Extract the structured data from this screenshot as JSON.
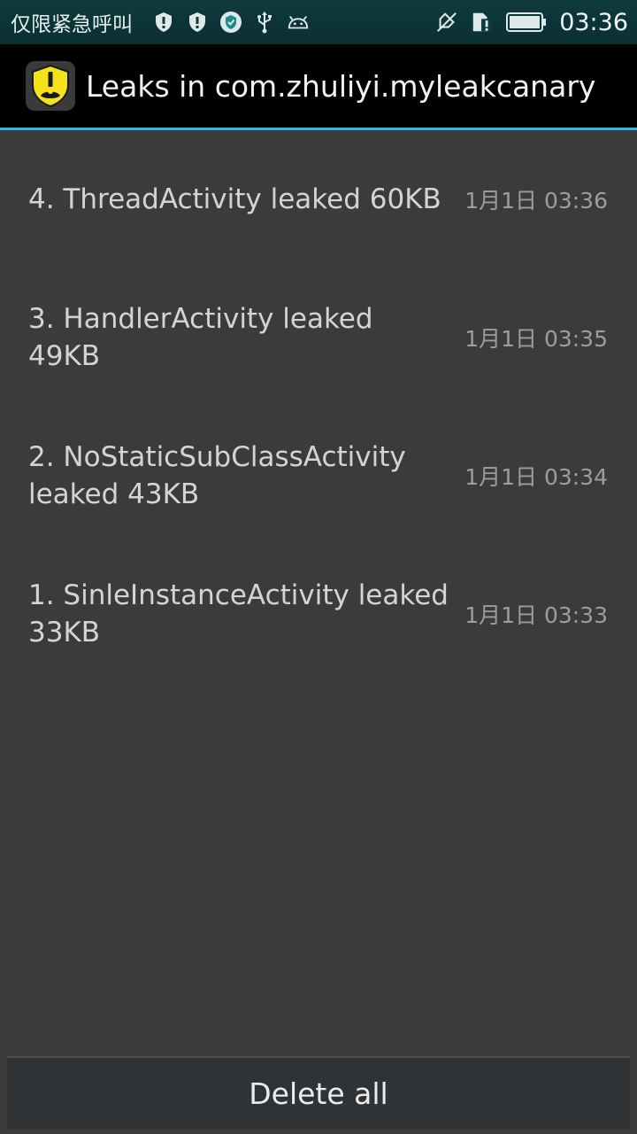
{
  "status_bar": {
    "carrier": "仅限紧急呼叫",
    "left_icons": [
      "shield-alert-icon",
      "shield-alert-icon",
      "shield-badge-icon",
      "usb-icon",
      "android-icon"
    ],
    "right_icons": [
      "mute-icon",
      "sim-alert-icon",
      "battery-icon"
    ],
    "time": "03:36"
  },
  "action_bar": {
    "title": "Leaks in com.zhuliyi.myleakcanary",
    "icon": "leakcanary-app-icon",
    "accent": "#33b5e5"
  },
  "leaks": [
    {
      "label": "4. ThreadActivity leaked 60KB",
      "time": "1月1日 03:36"
    },
    {
      "label": "3. HandlerActivity leaked 49KB",
      "time": "1月1日 03:35"
    },
    {
      "label": "2. NoStaticSubClassActivity leaked 43KB",
      "time": "1月1日 03:34"
    },
    {
      "label": "1. SinleInstanceActivity leaked 33KB",
      "time": "1月1日 03:33"
    }
  ],
  "footer": {
    "delete_all_label": "Delete all"
  }
}
